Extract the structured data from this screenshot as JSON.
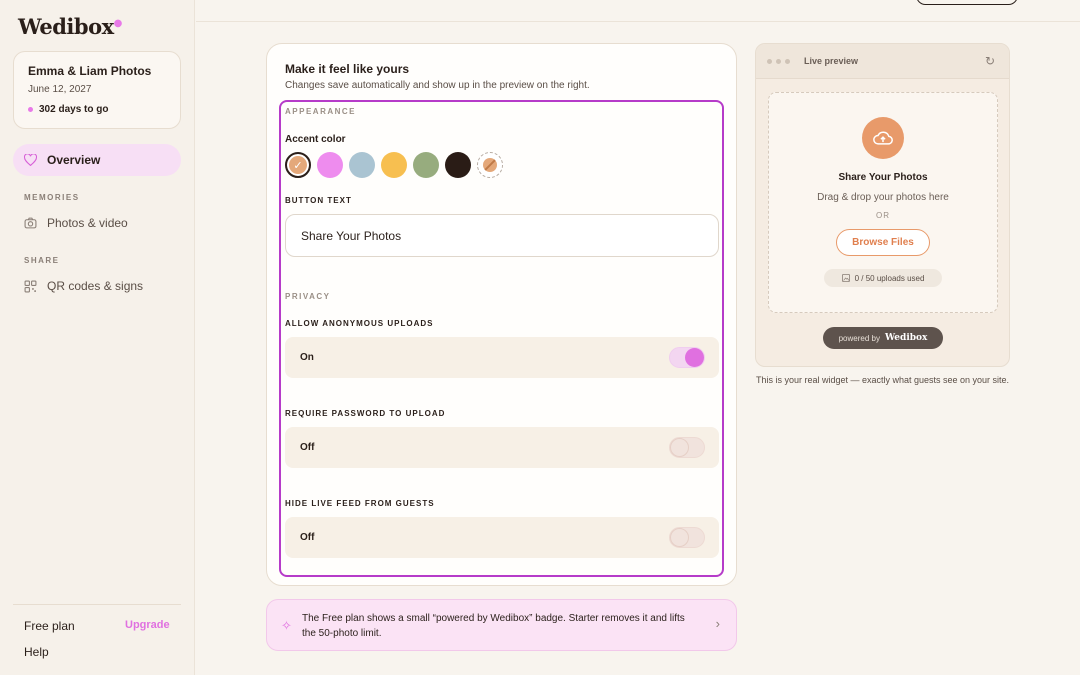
{
  "brand": {
    "name": "Wedibox"
  },
  "event": {
    "title": "Emma & Liam Photos",
    "date": "June 12, 2027",
    "countdown": "302 days to go"
  },
  "sidebar": {
    "overview": "Overview",
    "memories_section": "MEMORIES",
    "photos_video": "Photos & video",
    "share_section": "SHARE",
    "qr_codes": "QR codes & signs",
    "plan": "Free plan",
    "upgrade": "Upgrade",
    "help": "Help"
  },
  "card": {
    "title": "Make it feel like yours",
    "subtitle": "Changes save automatically and show up in the preview on the right.",
    "appearance_label": "APPEARANCE",
    "accent_label": "Accent color",
    "swatches": [
      "#e4a87a",
      "#ee8cee",
      "#aac4d2",
      "#f7bf50",
      "#97ac7e",
      "#2a1c16"
    ],
    "selected_swatch": 0,
    "button_text_label": "BUTTON TEXT",
    "button_text_value": "Share Your Photos",
    "privacy_label": "PRIVACY",
    "toggles": [
      {
        "label": "ALLOW ANONYMOUS UPLOADS",
        "state": "On"
      },
      {
        "label": "REQUIRE PASSWORD TO UPLOAD",
        "state": "Off"
      },
      {
        "label": "HIDE LIVE FEED FROM GUESTS",
        "state": "Off"
      }
    ]
  },
  "banner": {
    "text": "The Free plan shows a small “powered by Wedibox” badge. Starter removes it and lifts the 50-photo limit."
  },
  "preview": {
    "title": "Live preview",
    "widget_title": "Share Your Photos",
    "widget_sub": "Drag & drop your photos here",
    "or": "OR",
    "browse": "Browse Files",
    "uploads": "0 / 50 uploads used",
    "powered_prefix": "powered by",
    "powered_brand": "Wedibox",
    "note": "This is your real widget — exactly what guests see on your site."
  },
  "colors": {
    "accent_pink": "#e070e0",
    "upload_orange": "#e89a6a",
    "highlight": "#b63bc9"
  }
}
